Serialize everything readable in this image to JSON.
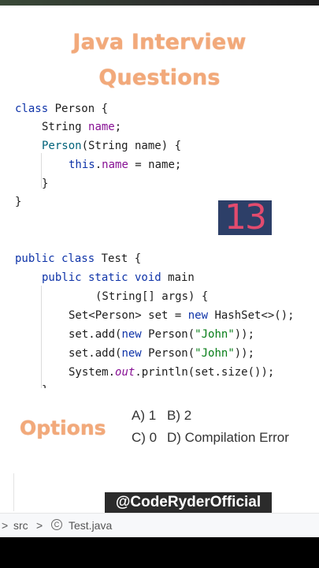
{
  "title": {
    "line1": "Java Interview",
    "line2": "Questions"
  },
  "question_number": "13",
  "code": {
    "line1": {
      "kw": "class",
      "rest": " Person {"
    },
    "line2": {
      "type": "String ",
      "field": "name",
      "end": ";"
    },
    "line3": {
      "ctor": "Person",
      "rest": "(String name) {"
    },
    "line4": {
      "kw": "this",
      "dot": ".",
      "field": "name",
      "rest": " = name;"
    },
    "line5": "}",
    "line6": "}",
    "line7": {
      "kw": "public class",
      "rest": " Test {"
    },
    "line8": {
      "kw": "public static void",
      "rest": " main"
    },
    "line9": "(String[] args) {",
    "line10": {
      "a": "Set<Person> set = ",
      "kw": "new",
      "b": " HashSet<>();"
    },
    "line11": {
      "a": "set.add(",
      "kw": "new",
      "b": " Person(",
      "str": "\"John\"",
      "c": "));"
    },
    "line12": {
      "a": "set.add(",
      "kw": "new",
      "b": " Person(",
      "str": "\"John\"",
      "c": "));"
    },
    "line13": {
      "a": "System.",
      "out": "out",
      "b": ".println(set.size());"
    },
    "line14": "}"
  },
  "options": {
    "label": "Options",
    "a": "A) 1",
    "b": "B) 2",
    "c": "C) 0",
    "d": "D) Compilation Error"
  },
  "watermark": "@CodeRyderOfficial",
  "breadcrumb": {
    "chevron": ">",
    "folder": "src",
    "chevron2": ">",
    "file": "Test.java",
    "icon": "class-icon"
  },
  "colors": {
    "title": "#f2a97a",
    "badge_bg": "#2d3f68",
    "badge_text": "#e24b6e",
    "keyword": "#0e33a8",
    "field": "#871094",
    "string": "#067d17"
  }
}
